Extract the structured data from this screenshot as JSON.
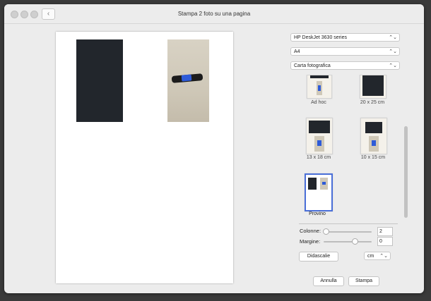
{
  "window": {
    "title": "Stampa 2 foto su una pagina",
    "back_icon": "chevron-left-icon"
  },
  "printer_select": {
    "value": "HP DeskJet 3630 series"
  },
  "paper_size_select": {
    "value": "A4"
  },
  "paper_type_select": {
    "value": "Carta fotografica"
  },
  "sizes": [
    {
      "label": "Ad hoc"
    },
    {
      "label": "20 x 25 cm"
    },
    {
      "label": "13 x 18 cm"
    },
    {
      "label": "10 x 15 cm"
    },
    {
      "label": "Provino"
    }
  ],
  "columns": {
    "label": "Colonne:",
    "value": "2",
    "fraction": 0.05
  },
  "margin": {
    "label": "Margine:",
    "value": "0",
    "fraction": 0.65
  },
  "captions_button": "Didascalie",
  "units_select": {
    "value": "cm"
  },
  "cancel_button": "Annulla",
  "print_button": "Stampa",
  "colors": {
    "window_bg": "#ececec",
    "selection_border": "#4a6fd8",
    "usb_blue": "#2e5bd8"
  }
}
